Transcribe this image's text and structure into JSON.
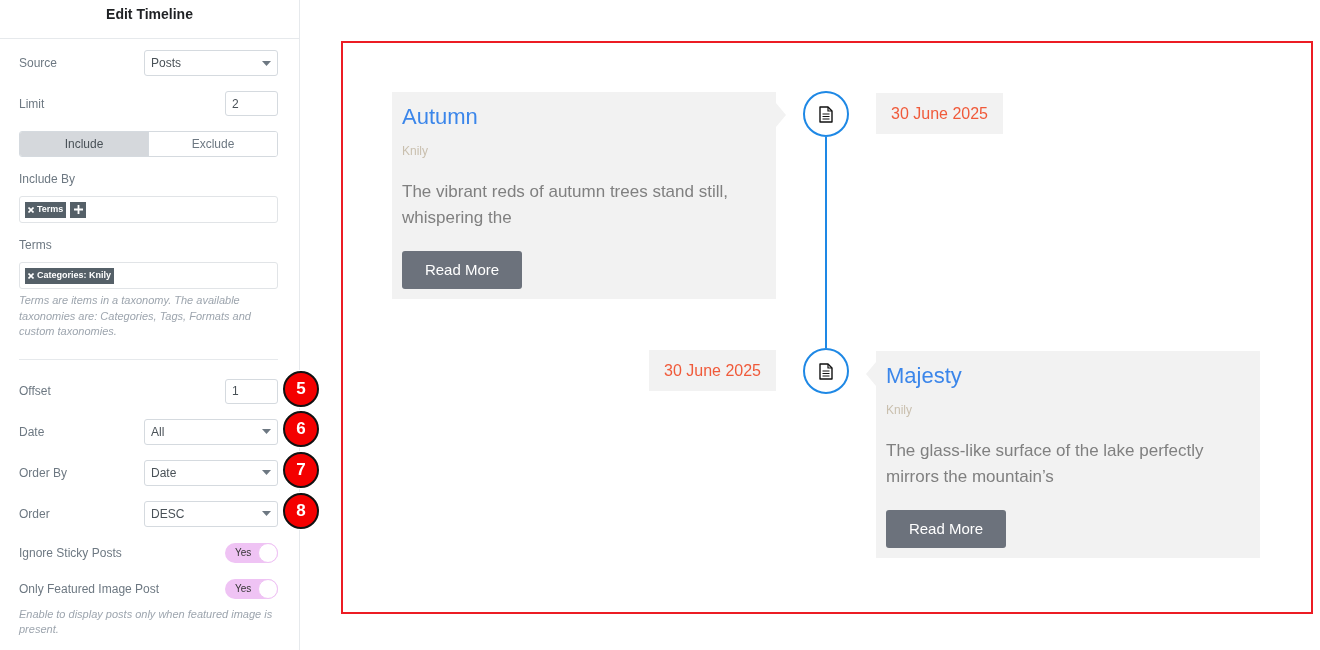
{
  "panel": {
    "title": "Edit Timeline"
  },
  "settings": [
    {
      "kind": "select",
      "label": "Source",
      "value": "Posts"
    },
    {
      "kind": "number",
      "label": "Limit",
      "value": "2"
    },
    {
      "kind": "segmented",
      "options": [
        {
          "label": "Include",
          "selected": true
        },
        {
          "label": "Exclude",
          "selected": false
        }
      ]
    },
    {
      "kind": "tags",
      "label": "Include By",
      "tags": [
        "Terms"
      ],
      "addable": true
    },
    {
      "kind": "tags",
      "label": "Terms",
      "tags": [
        "Categories: Knily"
      ],
      "addable": false,
      "help": "Terms are items in a taxonomy. The available taxonomies are: Categories, Tags, Formats and custom taxonomies."
    },
    {
      "kind": "divider"
    },
    {
      "kind": "number",
      "label": "Offset",
      "value": "1",
      "callout": "5"
    },
    {
      "kind": "select",
      "label": "Date",
      "value": "All",
      "callout": "6"
    },
    {
      "kind": "select",
      "label": "Order By",
      "value": "Date",
      "callout": "7"
    },
    {
      "kind": "select",
      "label": "Order",
      "value": "DESC",
      "callout": "8"
    },
    {
      "kind": "switch",
      "label": "Ignore Sticky Posts",
      "on": true,
      "state_text": "Yes"
    },
    {
      "kind": "switch",
      "label": "Only Featured Image Post",
      "on": true,
      "state_text": "Yes",
      "help": "Enable to display posts only when featured image is present."
    }
  ],
  "timeline": {
    "items": [
      {
        "kind": "left",
        "title": "Autumn",
        "author": "Knily",
        "excerpt": "The vibrant reds of autumn trees stand still, whispering the",
        "button": "Read More",
        "date": "30 June 2025"
      },
      {
        "kind": "right",
        "title": "Majesty",
        "author": "Knily",
        "excerpt": "The glass-like surface of the lake perfectly mirrors the mountain’s",
        "button": "Read More",
        "date": "30 June 2025"
      }
    ]
  }
}
